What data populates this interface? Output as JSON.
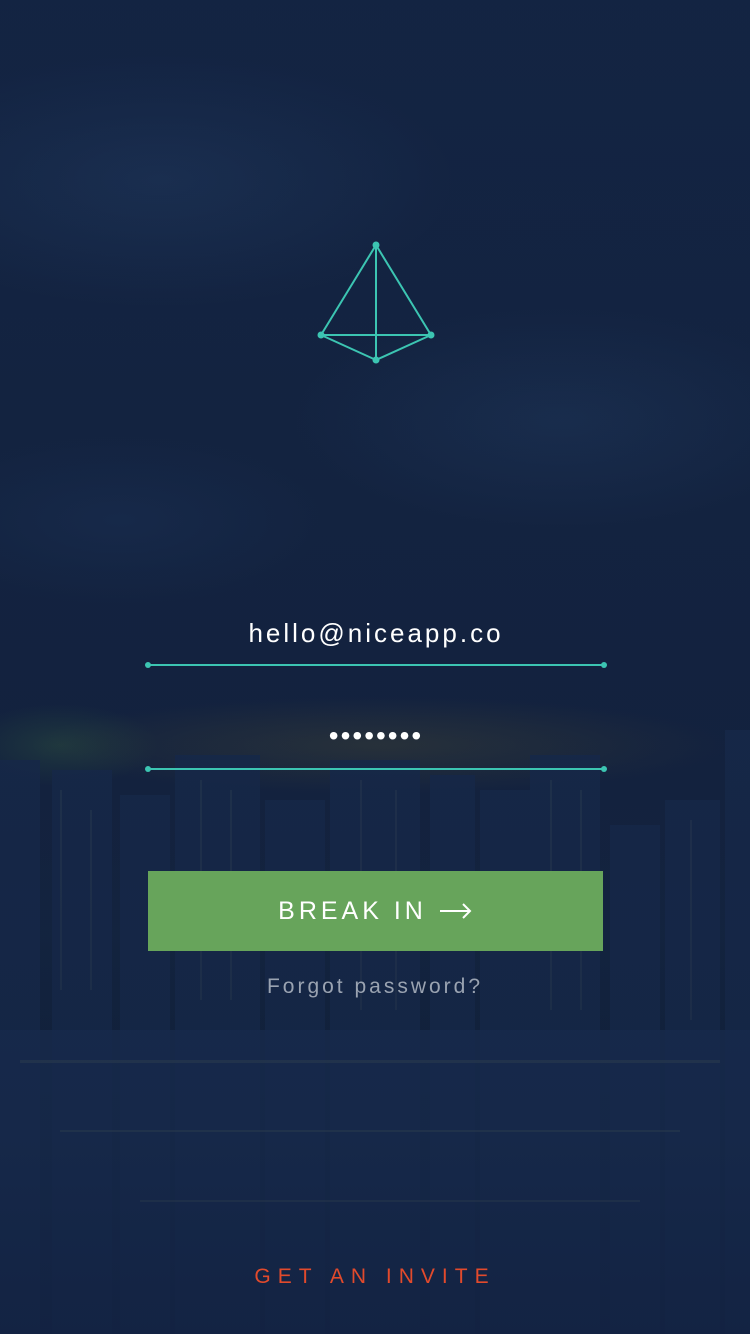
{
  "colors": {
    "background": "#132340",
    "accent": "#3cc5b2",
    "button": "#67a45b",
    "invite": "#e24a2c",
    "muted_text": "#9aa3b1"
  },
  "logo": {
    "icon": "pyramid-icon"
  },
  "login": {
    "email_value": "hello@niceapp.co",
    "password_value": "••••••••",
    "submit_label": "BREAK IN",
    "submit_icon": "arrow-right-icon",
    "forgot_label": "Forgot password?"
  },
  "footer": {
    "invite_label": "GET AN INVITE"
  }
}
